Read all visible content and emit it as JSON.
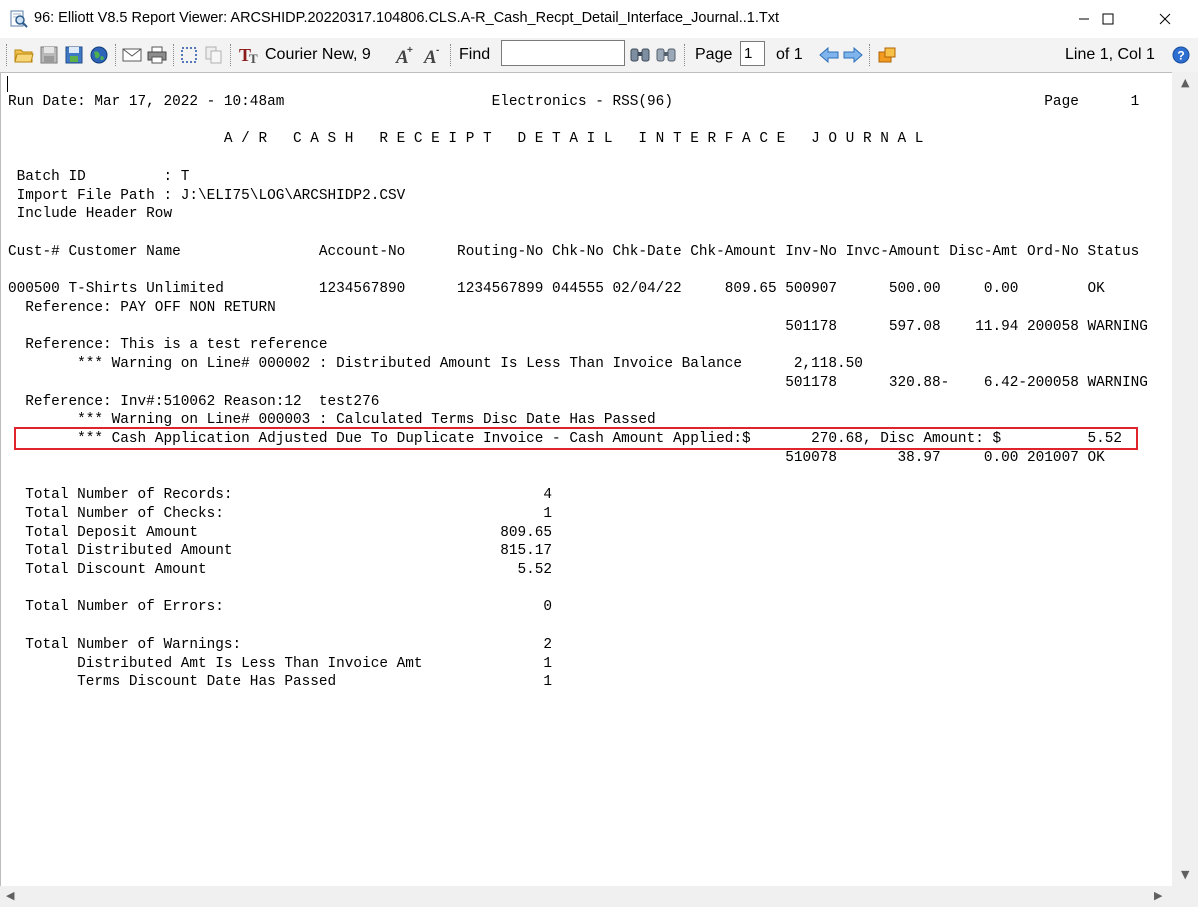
{
  "window": {
    "title": "96: Elliott V8.5 Report Viewer: ARCSHIDP.20220317.104806.CLS.A-R_Cash_Recpt_Detail_Interface_Journal..1.Txt",
    "icon": "magnifier-document-icon"
  },
  "toolbar": {
    "font_label": "Courier New, 9",
    "find_label": "Find",
    "find_value": "",
    "page_label": "Page",
    "page_value": "1",
    "page_of": "of 1",
    "position": "Line 1, Col 1"
  },
  "report": {
    "lines": [
      "Run Date: Mar 17, 2022 - 10:48am                        Electronics - RSS(96)                                           Page      1",
      "",
      "                         A / R   C A S H   R E C E I P T   D E T A I L   I N T E R F A C E   J O U R N A L",
      "",
      " Batch ID         : T",
      " Import File Path : J:\\ELI75\\LOG\\ARCSHIDP2.CSV",
      " Include Header Row",
      "",
      "Cust-# Customer Name                Account-No      Routing-No Chk-No Chk-Date Chk-Amount Inv-No Invc-Amount Disc-Amt Ord-No Status",
      "",
      "000500 T-Shirts Unlimited           1234567890      1234567899 044555 02/04/22     809.65 500907      500.00     0.00        OK",
      "  Reference: PAY OFF NON RETURN",
      "                                                                                          501178      597.08    11.94 200058 WARNING",
      "  Reference: This is a test reference",
      "        *** Warning on Line# 000002 : Distributed Amount Is Less Than Invoice Balance      2,118.50",
      "                                                                                          501178      320.88-    6.42-200058 WARNING",
      "  Reference: Inv#:510062 Reason:12  test276",
      "        *** Warning on Line# 000003 : Calculated Terms Disc Date Has Passed",
      "        *** Cash Application Adjusted Due To Duplicate Invoice - Cash Amount Applied:$       270.68, Disc Amount: $          5.52",
      "                                                                                          510078       38.97     0.00 201007 OK",
      "",
      "  Total Number of Records:                                    4",
      "  Total Number of Checks:                                     1",
      "  Total Deposit Amount                                   809.65",
      "  Total Distributed Amount                               815.17",
      "  Total Discount Amount                                    5.52",
      "",
      "  Total Number of Errors:                                     0",
      "",
      "  Total Number of Warnings:                                   2",
      "        Distributed Amt Is Less Than Invoice Amt              1",
      "        Terms Discount Date Has Passed                        1"
    ]
  }
}
